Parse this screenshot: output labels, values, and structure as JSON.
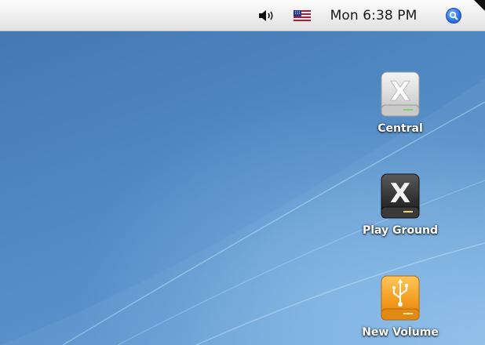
{
  "menubar": {
    "clock": "Mon 6:38 PM",
    "icons": [
      "volume-icon",
      "us-flag-icon",
      "spotlight-icon"
    ]
  },
  "desktop": {
    "items": [
      {
        "label": "Central",
        "icon": "mac-os-x-drive-icon",
        "style": "silver"
      },
      {
        "label": "Play Ground",
        "icon": "mac-os-x-drive-icon",
        "style": "dark"
      },
      {
        "label": "New Volume",
        "icon": "usb-drive-icon",
        "style": "orange"
      }
    ]
  },
  "colors": {
    "desktop_blue": "#4f88c2",
    "spotlight_blue": "#2a6fe8",
    "usb_orange": "#f39a1e"
  }
}
